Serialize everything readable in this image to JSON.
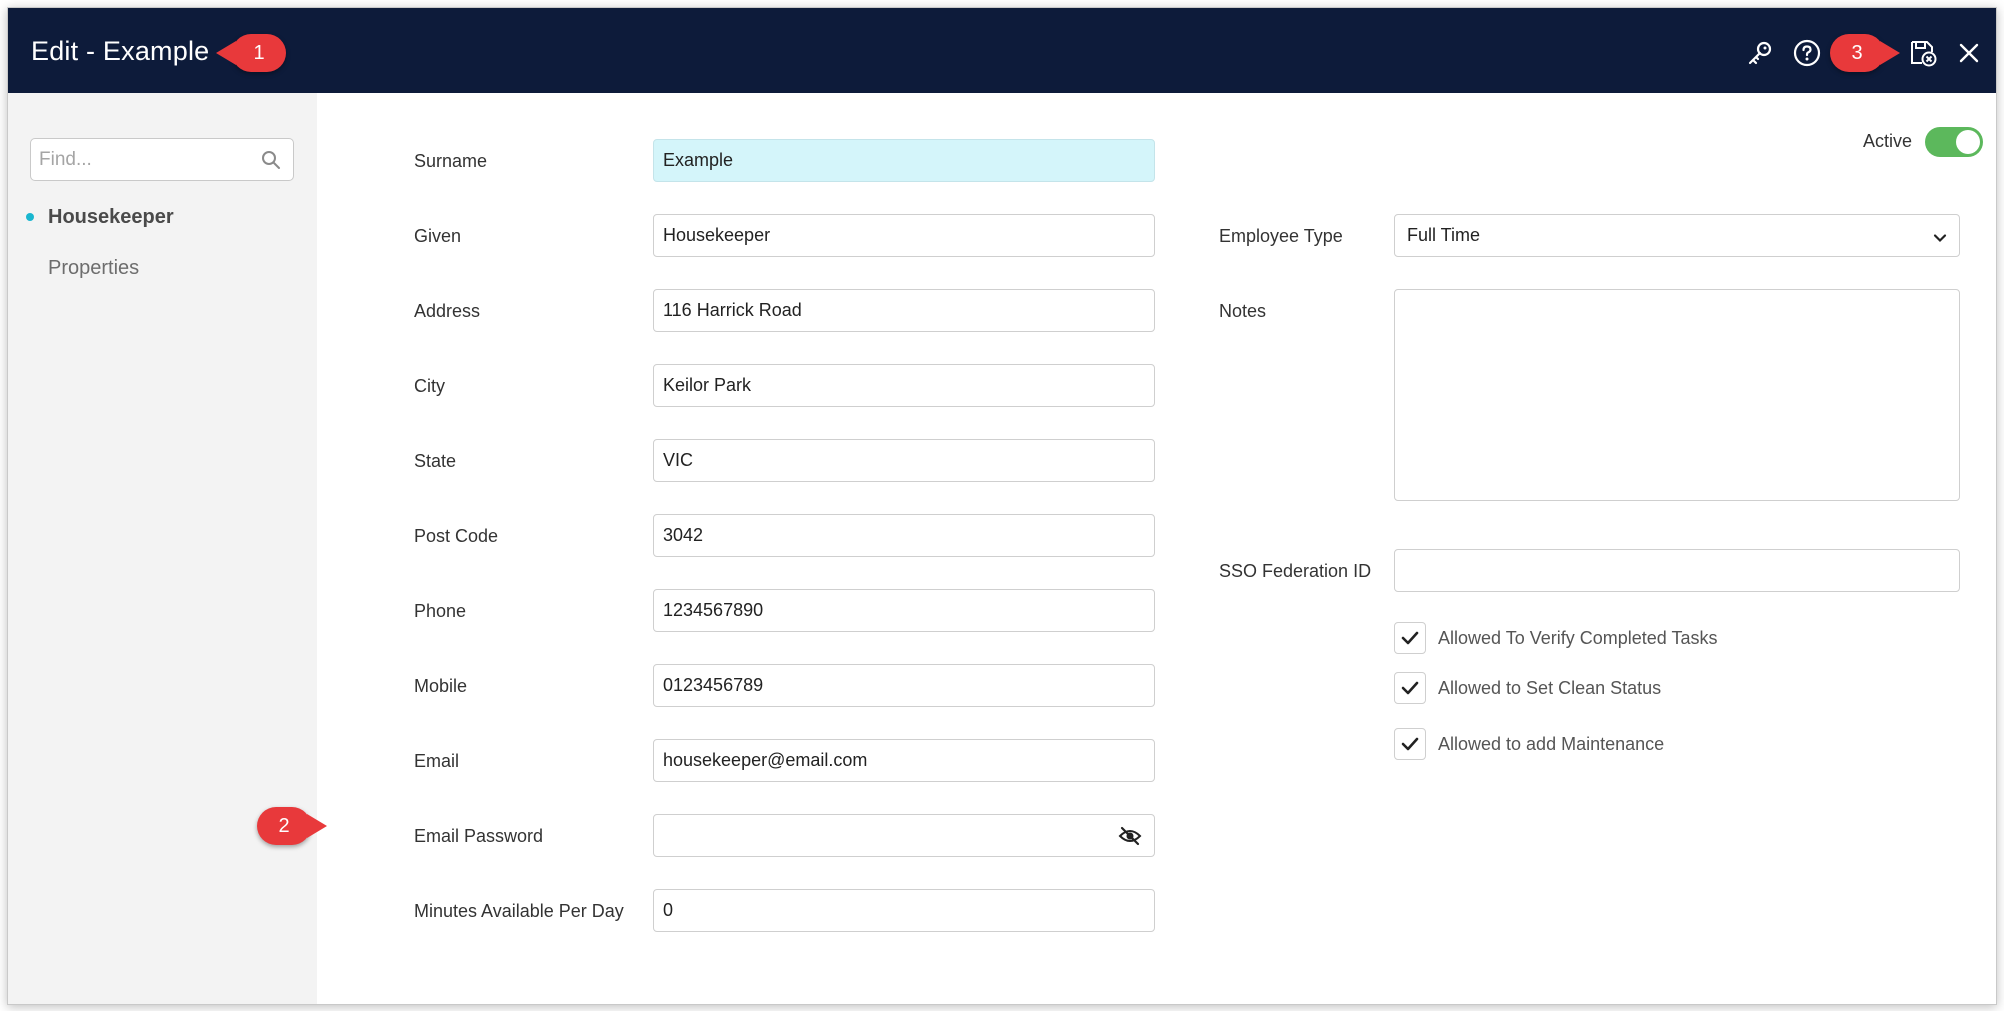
{
  "header": {
    "title": "Edit - Example",
    "callouts": [
      "1",
      "2",
      "3"
    ],
    "icons": [
      "key-icon",
      "help-icon",
      "save-close-icon",
      "close-icon"
    ]
  },
  "sidebar": {
    "find_placeholder": "Find...",
    "items": [
      {
        "label": "Housekeeper",
        "active": true
      },
      {
        "label": "Properties",
        "active": false
      }
    ]
  },
  "form": {
    "active_label": "Active",
    "active": true,
    "left_fields": [
      {
        "label": "Surname",
        "value": "Example"
      },
      {
        "label": "Given",
        "value": "Housekeeper"
      },
      {
        "label": "Address",
        "value": "116 Harrick Road"
      },
      {
        "label": "City",
        "value": "Keilor Park"
      },
      {
        "label": "State",
        "value": "VIC"
      },
      {
        "label": "Post Code",
        "value": "3042"
      },
      {
        "label": "Phone",
        "value": "1234567890"
      },
      {
        "label": "Mobile",
        "value": "0123456789"
      },
      {
        "label": "Email",
        "value": "housekeeper@email.com"
      },
      {
        "label": "Email Password",
        "value": ""
      },
      {
        "label": "Minutes Available Per Day",
        "value": "0"
      }
    ],
    "employee_type": {
      "label": "Employee Type",
      "value": "Full Time"
    },
    "notes": {
      "label": "Notes",
      "value": ""
    },
    "sso": {
      "label": "SSO Federation ID",
      "value": ""
    },
    "checkboxes": [
      {
        "label": "Allowed To Verify Completed Tasks",
        "checked": true
      },
      {
        "label": "Allowed to Set Clean Status",
        "checked": true
      },
      {
        "label": "Allowed to add Maintenance",
        "checked": true
      }
    ]
  },
  "colors": {
    "topbar": "#0d1b3a",
    "callout": "#e8393b",
    "toggle_on": "#5cb85c",
    "highlight_field": "#d4f5fa",
    "sidebar_dot": "#19b6cf"
  }
}
